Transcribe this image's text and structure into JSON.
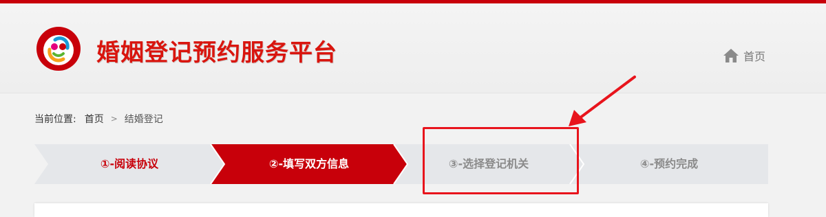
{
  "header": {
    "site_title": "婚姻登记预约服务平台",
    "home_label": "首页"
  },
  "breadcrumb": {
    "prefix": "当前位置:",
    "home": "首页",
    "separator": ">",
    "current": "结婚登记"
  },
  "steps": [
    {
      "label": "①-阅读协议",
      "state": "done"
    },
    {
      "label": "②-填写双方信息",
      "state": "active"
    },
    {
      "label": "③-选择登记机关",
      "state": "pending"
    },
    {
      "label": "④-预约完成",
      "state": "pending"
    }
  ],
  "colors": {
    "brand_red": "#c8000a",
    "title_red": "#d9150e",
    "step_inactive": "#e5e7ea",
    "annotation_red": "#e8141c"
  }
}
